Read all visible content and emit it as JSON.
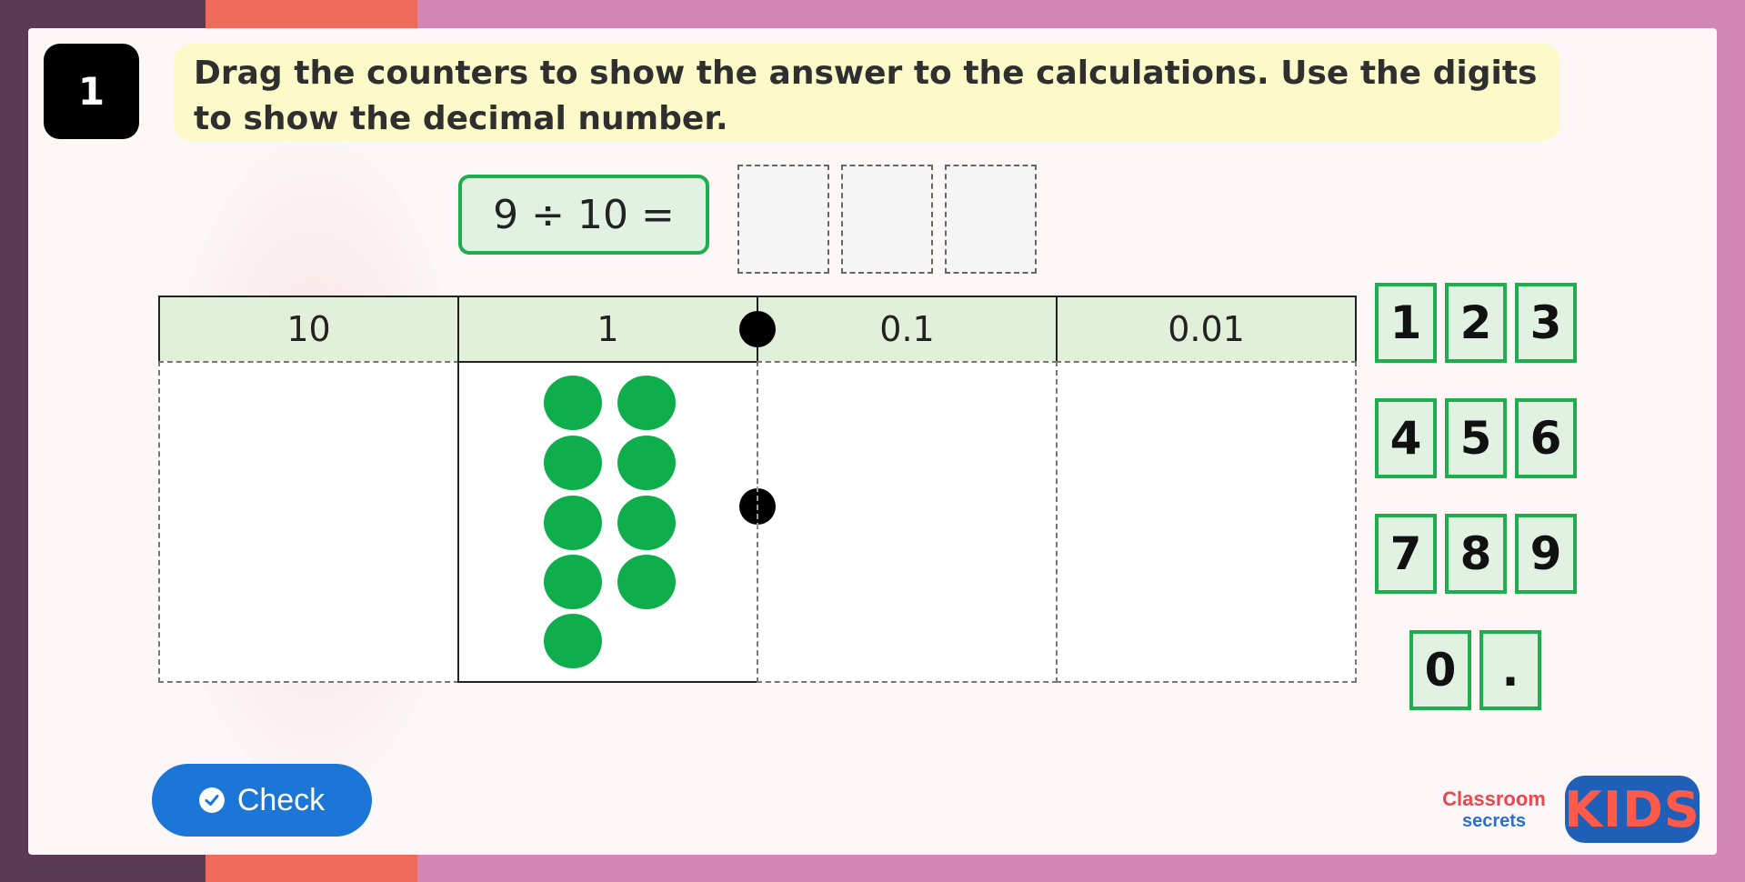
{
  "question": {
    "number": "1",
    "instruction": "Drag the counters to show the answer to the calculations. Use the digits to show the decimal number."
  },
  "calculation": "9 ÷ 10 =",
  "place_value": {
    "headers": [
      "10",
      "1",
      "0.1",
      "0.01"
    ],
    "counters": {
      "column": "1",
      "count": 9
    }
  },
  "digit_cards": {
    "row1": [
      "1",
      "2",
      "3"
    ],
    "row2": [
      "4",
      "5",
      "6"
    ],
    "row3": [
      "7",
      "8",
      "9"
    ],
    "row4": [
      "0",
      "."
    ]
  },
  "check_button": {
    "label": "Check"
  },
  "logo": {
    "line1": "Classroom",
    "line2": "secrets",
    "kids": "KIDS"
  },
  "colors": {
    "accent_green": "#1fae4e",
    "counter_green": "#0fae4c",
    "button_blue": "#1c76d8",
    "instruction_bg": "#fdfac9"
  }
}
